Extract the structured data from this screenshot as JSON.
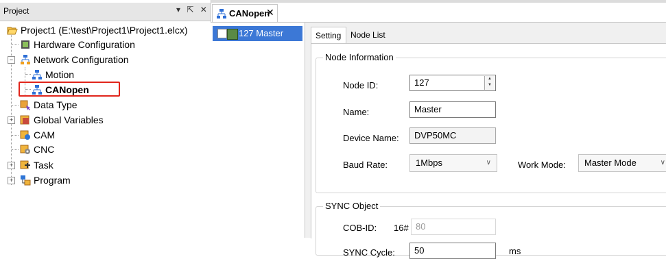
{
  "project_panel": {
    "title": "Project",
    "header_buttons": "▾ ⇱ ✕",
    "tree": {
      "root": "Project1 (E:\\test\\Project1\\Project1.elcx)",
      "hardware": "Hardware Configuration",
      "network": "Network Configuration",
      "motion": "Motion",
      "canopen": "CANopen",
      "data_type": "Data Type",
      "global_vars": "Global Variables",
      "cam": "CAM",
      "cnc": "CNC",
      "task": "Task",
      "program": "Program"
    }
  },
  "doc_tab": {
    "label": "CANopen",
    "close": "✕"
  },
  "node_list": {
    "item_label": "127 Master"
  },
  "config": {
    "tabs": {
      "setting": "Setting",
      "node_list": "Node List"
    },
    "node_info": {
      "title": "Node Information",
      "node_id_label": "Node ID:",
      "node_id": "127",
      "name_label": "Name:",
      "name": "Master",
      "device_name_label": "Device Name:",
      "device_name": "DVP50MC",
      "baud_rate_label": "Baud Rate:",
      "baud_rate": "1Mbps",
      "work_mode_label": "Work Mode:",
      "work_mode": "Master Mode"
    },
    "sync": {
      "title": "SYNC Object",
      "cob_id_label": "COB-ID:",
      "cob_prefix": "16#",
      "cob_id": "80",
      "cycle_label": "SYNC Cycle:",
      "cycle": "50",
      "cycle_unit": "ms"
    }
  },
  "colors": {
    "selection": "#3c78d6",
    "highlight": "#e1251b",
    "accent": "#2e75d6"
  }
}
